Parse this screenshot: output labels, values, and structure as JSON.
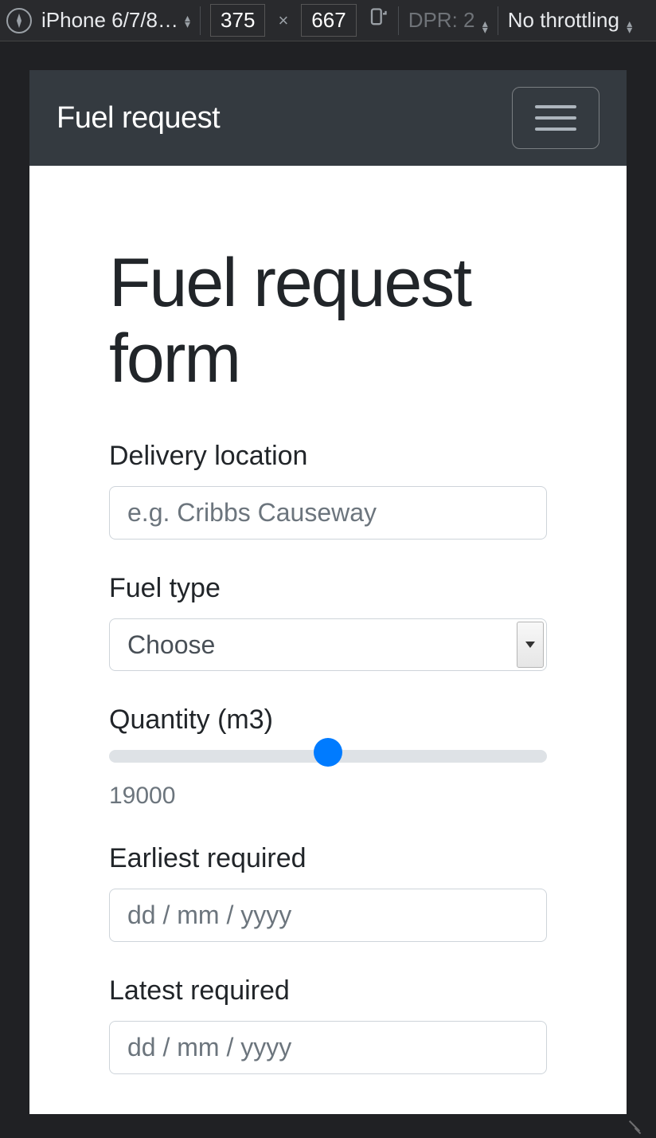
{
  "devtools": {
    "device_label": "iPhone 6/7/8…",
    "width": "375",
    "height": "667",
    "dpr_label": "DPR: 2",
    "throttle_label": "No throttling"
  },
  "navbar": {
    "brand": "Fuel request"
  },
  "page": {
    "title": "Fuel request form"
  },
  "form": {
    "location": {
      "label": "Delivery location",
      "placeholder": "e.g. Cribbs Causeway",
      "value": ""
    },
    "fuel_type": {
      "label": "Fuel type",
      "selected": "Choose"
    },
    "quantity": {
      "label": "Quantity (m3)",
      "value": "19000",
      "min": "0",
      "max": "38000"
    },
    "earliest": {
      "label": "Earliest required",
      "placeholder": "dd / mm / yyyy"
    },
    "latest": {
      "label": "Latest required",
      "placeholder": "dd / mm / yyyy"
    }
  }
}
